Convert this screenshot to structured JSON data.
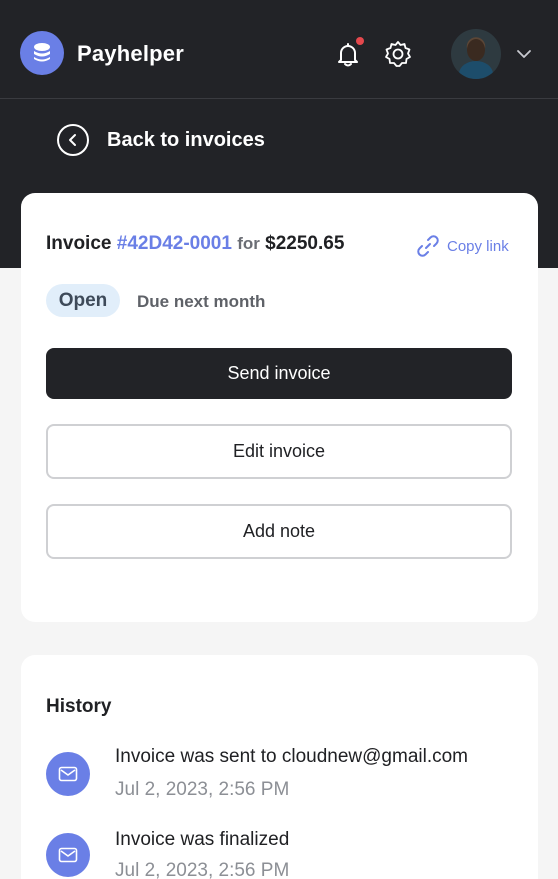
{
  "app": {
    "name": "Payhelper"
  },
  "header": {
    "has_notification": true,
    "colors": {
      "bg": "#222327",
      "accent": "#6a7fe6",
      "notification_dot": "#e5484d"
    }
  },
  "nav": {
    "back_label": "Back to invoices"
  },
  "invoice": {
    "prefix": "Invoice",
    "number": "#42D42-0001",
    "for_label": "for",
    "amount": "$2250.65",
    "copy_link_label": "Copy link",
    "status": "Open",
    "due_text": "Due next month",
    "actions": {
      "send": "Send invoice",
      "edit": "Edit invoice",
      "note": "Add note"
    }
  },
  "history": {
    "title": "History",
    "items": [
      {
        "text": "Invoice was sent to cloudnew@gmail.com",
        "date": "Jul 2, 2023, 2:56 PM"
      },
      {
        "text": "Invoice was finalized",
        "date": "Jul 2, 2023, 2:56 PM"
      }
    ]
  }
}
